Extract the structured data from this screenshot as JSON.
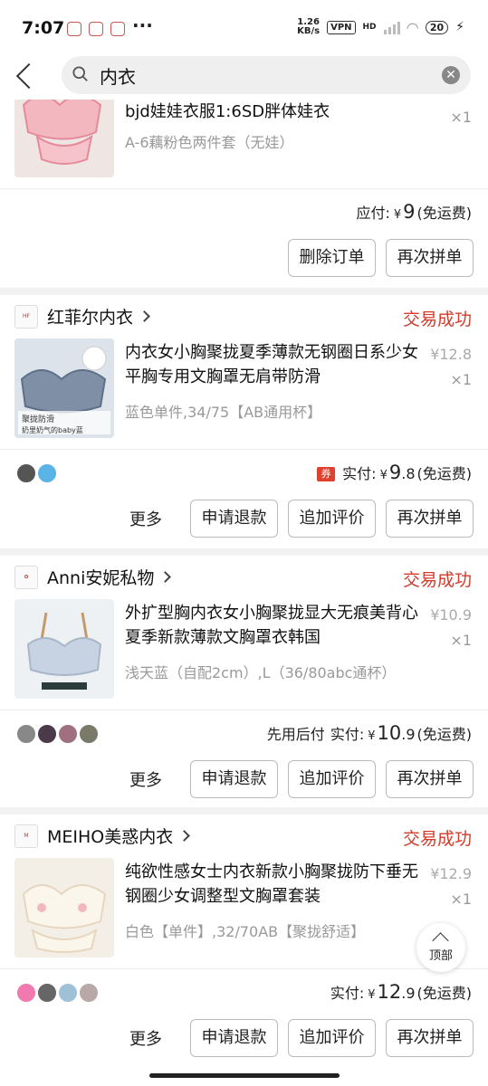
{
  "status_bar": {
    "time": "7:07",
    "more": "···",
    "net_speed_value": "1.26",
    "net_speed_unit": "KB/s",
    "vpn": "VPN",
    "hd": "HD",
    "battery": "20"
  },
  "search": {
    "query": "内衣",
    "placeholder": "内衣"
  },
  "orders": [
    {
      "title": "bjd娃娃衣服1:6SD胖体娃衣",
      "sku": "A-6藕粉色两件套（无娃）",
      "qty": "×1",
      "pay_label": "应付:",
      "yen": "¥",
      "amount_int": "9",
      "amount_dec": "",
      "shipping": "(免运费)",
      "buttons": [
        "删除订单",
        "再次拼单"
      ]
    },
    {
      "shop": "红菲尔内衣",
      "status": "交易成功",
      "title": "内衣女小胸聚拢夏季薄款无钢圈日系少女平胸专用文胸罩无肩带防滑",
      "sku": "蓝色单件,34/75【AB通用杯】",
      "unit_price": "¥12.8",
      "qty": "×1",
      "coupon": "券",
      "pay_label": "实付:",
      "yen": "¥",
      "amount_int": "9",
      "amount_dec": ".8",
      "shipping": "(免运费)",
      "more": "更多",
      "buttons": [
        "申请退款",
        "追加评价",
        "再次拼单"
      ],
      "thumb_text_1": "聚拢防滑",
      "thumb_text_2": "奶里奶气的baby蓝"
    },
    {
      "shop": "Anni安妮私物",
      "status": "交易成功",
      "title": "外扩型胸内衣女小胸聚拢显大无痕美背心夏季新款薄款文胸罩衣韩国",
      "sku": "浅天蓝（自配2cm）,L（36/80abc通杯）",
      "unit_price": "¥10.9",
      "qty": "×1",
      "pre_label": "先用后付",
      "pay_label": "实付:",
      "yen": "¥",
      "amount_int": "10",
      "amount_dec": ".9",
      "shipping": "(免运费)",
      "more": "更多",
      "buttons": [
        "申请退款",
        "追加评价",
        "再次拼单"
      ]
    },
    {
      "shop": "MEIHO美惑内衣",
      "status": "交易成功",
      "title": "纯欲性感女士内衣新款小胸聚拢防下垂无钢圈少女调整型文胸罩套装",
      "sku": "白色【单件】,32/70AB【聚拢舒适】",
      "unit_price": "¥12.9",
      "qty": "×1",
      "pay_label": "实付:",
      "yen": "¥",
      "amount_int": "12",
      "amount_dec": ".9",
      "shipping": "(免运费)",
      "more": "更多",
      "buttons": [
        "申请退款",
        "追加评价",
        "再次拼单"
      ]
    }
  ],
  "back_to_top": "顶部",
  "colors": {
    "accent_red": "#d43b2a",
    "background": "#f2f2f2",
    "muted": "#999999"
  }
}
